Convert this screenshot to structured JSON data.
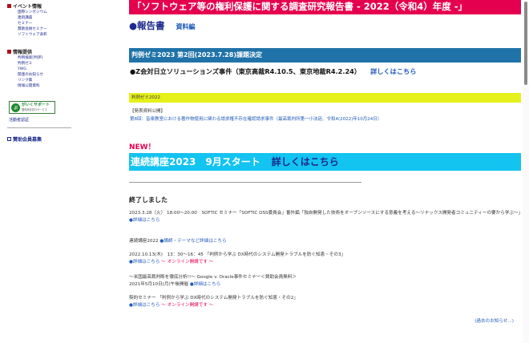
{
  "sidebar": {
    "events": {
      "heading": "イベント情報",
      "items": [
        "国際シンポジウム",
        "連続講座",
        "セミナー",
        "賛助会員セミナー",
        "ソフトウェア表彰"
      ]
    },
    "info": {
      "heading": "情報提供",
      "items": [
        "判例検索[判評]",
        "判例ゼミ",
        "YWG",
        "関連のお知らせ",
        "リンク集",
        "情報公開資料"
      ]
    },
    "badge": {
      "icon_text": "ぷ",
      "title": "がいくサポート",
      "subtitle": "国内総合窓口サービス"
    },
    "badge_link": "活動者認証",
    "members": {
      "heading": "賛助会員募集"
    }
  },
  "main": {
    "title": "「ソフトウェア等の権利保護に関する調査研究報告書 - 2022（令和4）年度 -」",
    "report_label": "●報告書",
    "report_sub": "資料編",
    "seminar_bar": "判例ゼミ2023 第2回(2023.7.28)課題決定",
    "case_text": "●Z会対日立ソリューションズ事件（東京高裁R4.10.5、東京地裁R4.2.24）",
    "case_link": "詳しくはこちら",
    "yellow_bar": "判例ゼミ2022",
    "publication_head": "【発表資料公開】",
    "publication_link": "第8回：音楽教室における著作物使用に関わる請求権不存在確認請求事件（最高裁判所第一小法廷、令和4(2022)年10月24日）",
    "new_label": "NEW！",
    "course_bar": "連続講座2023　9月スタート",
    "course_link": "詳しくはこちら",
    "ended_heading": "終了しました",
    "events": [
      {
        "line": "2023.3.28（火） 18:00～20:00　SOFTIC セミナー「SOFTIC OSS委員会」番外編「独自開発した技術をオープンソースにする意義を考える～リナックス開発者コミュニティーの要から学ぶ～」",
        "link": "●詳細はこちら"
      },
      {
        "line": "連続講座2022",
        "link": "●講師・テーマなど詳細はこちら"
      },
      {
        "line": "2022.10.13(木)　13：30～16：45 「判例から学ぶ DX時代のシステム開発トラブルを防ぐ知恵・その3」",
        "link": "●詳細はこちら",
        "note": "～ オンライン開講です ～"
      },
      {
        "line": "～米国最高裁判断を徹底分析!!～ Google v. Oracle事件セミナー＜賛助会員無料＞",
        "line2": "2021年5月10日(月)午後開催",
        "link": "●詳細はこちら"
      },
      {
        "line": "契約セミナー 「判例から学ぶ DX時代のシステム開発トラブルを防ぐ知恵・その2」",
        "link": "●詳細はこちら",
        "note": "～ オンライン開講です ～"
      }
    ],
    "past_link": "(過去のお知らせ...)"
  }
}
